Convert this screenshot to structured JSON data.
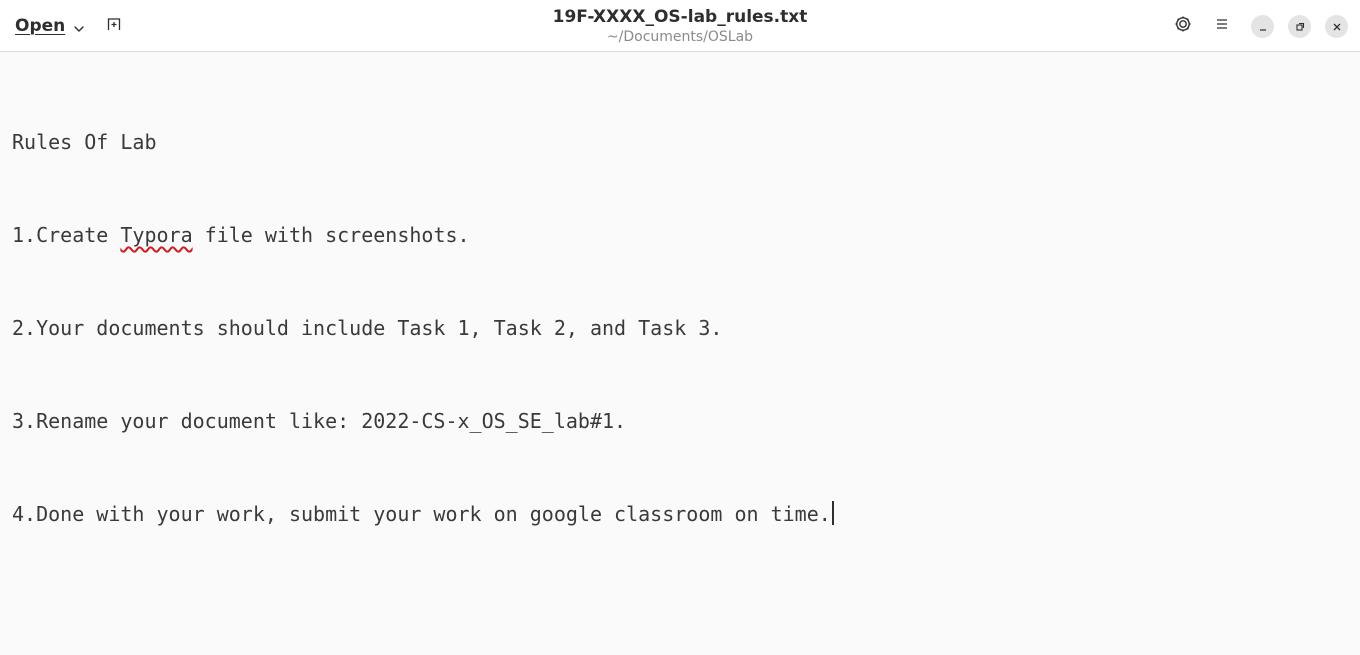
{
  "header": {
    "open_label": "Open",
    "title": "19F-XXXX_OS-lab_rules.txt",
    "subtitle": "~/Documents/OSLab",
    "icons": {
      "open_dropdown": "chevron-down-icon",
      "new_tab": "new-tab-icon",
      "settings": "settings-icon",
      "menu": "hamburger-menu-icon",
      "minimize": "minimize-icon",
      "maximize": "maximize-icon",
      "close": "close-icon"
    }
  },
  "document": {
    "lines": [
      "Rules Of Lab",
      "1.Create ",
      "Typora",
      " file with screenshots.",
      "2.Your documents should include Task 1, Task 2, and Task 3.",
      "3.Rename your document like: 2022-CS-x_OS_SE_lab#1.",
      "4.Done with your work, submit your work on google classroom on time."
    ],
    "misspelled_word": "Typora"
  },
  "colors": {
    "header_bg": "#ffffff",
    "editor_bg": "#fafafa",
    "text": "#3a3a3a",
    "spellcheck_underline": "#d01c1c",
    "window_button_bg": "#e4e4e4"
  }
}
